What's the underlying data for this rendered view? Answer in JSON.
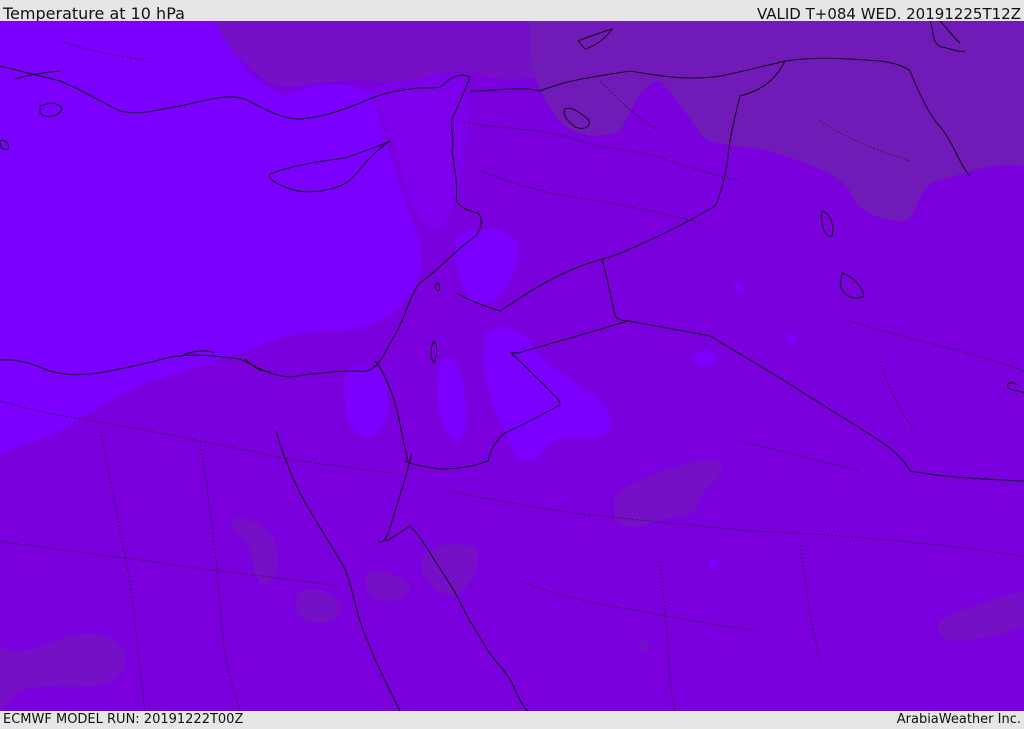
{
  "header": {
    "title": "Temperature at 10 hPa",
    "valid": "VALID T+084 WED. 20191225T12Z"
  },
  "footer": {
    "model_run": "ECMWF MODEL RUN: 20191222T00Z",
    "credit": "ArabiaWeather Inc."
  },
  "map": {
    "variable": "temperature",
    "level": "10 hPa",
    "colors": {
      "coldest": "#7b00ff",
      "cold": "#7f00ec",
      "base": "#7a00de",
      "warm": "#7510c6",
      "warmer": "#701ab8",
      "coastline": "#111111",
      "borders": "#222222"
    }
  }
}
